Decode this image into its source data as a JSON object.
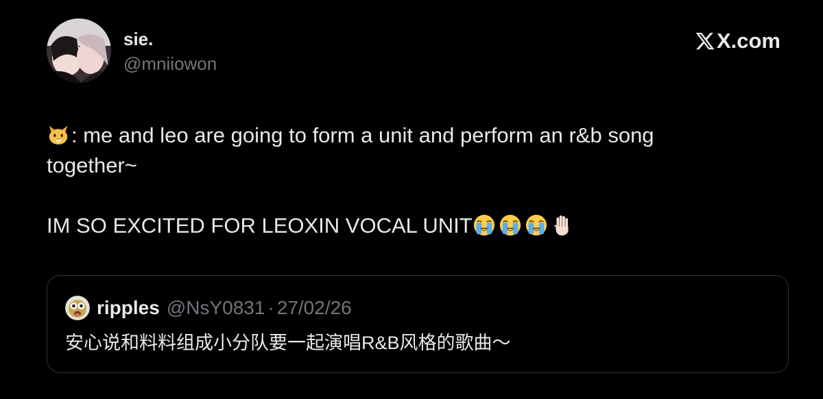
{
  "author": {
    "display_name": "sie.",
    "handle": "@mniiowon",
    "avatar_icon": "profile-photo"
  },
  "brand": {
    "logo_icon": "x-logo-icon",
    "domain": "X.com"
  },
  "tweet": {
    "line1_text": ": me and leo are going to form a unit and perform an r&b song",
    "line2_text": "together~",
    "line3_text": "IM SO EXCITED FOR LEOXIN VOCAL UNIT",
    "emojis": [
      "cat-face",
      "loudly-crying-face",
      "loudly-crying-face",
      "loudly-crying-face",
      "raised-hand"
    ]
  },
  "quote": {
    "avatar_icon": "quote-avatar-emoji",
    "name": "ripples",
    "handle": "@NsY0831",
    "separator": "·",
    "date": "27/02/26",
    "text": "安心说和料料组成小分队要一起演唱R&B风格的歌曲～"
  },
  "colors": {
    "background": "#000000",
    "primary_text": "#e7e9ea",
    "secondary_text": "#71767b",
    "card_border": "#2f3336"
  }
}
